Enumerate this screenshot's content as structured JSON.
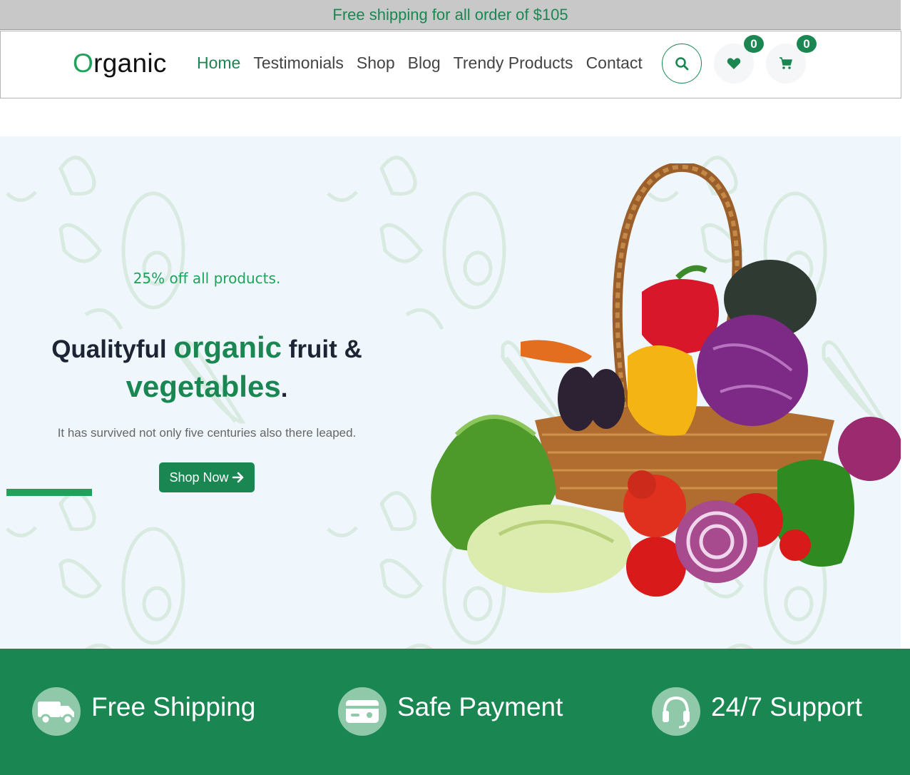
{
  "announcement": "Free shipping for all order of $105",
  "logo": {
    "first_letter": "O",
    "rest": "rganic"
  },
  "nav": [
    {
      "label": "Home",
      "active": true
    },
    {
      "label": "Testimonials"
    },
    {
      "label": "Shop"
    },
    {
      "label": "Blog"
    },
    {
      "label": "Trendy Products"
    },
    {
      "label": "Contact"
    }
  ],
  "icons": {
    "search": "search-icon",
    "wishlist": "heart-icon",
    "cart": "cart-icon"
  },
  "counts": {
    "wishlist": "0",
    "cart": "0"
  },
  "hero": {
    "promo": "25% off all products.",
    "headline": {
      "part1": "Qualityful ",
      "part2": "organic",
      "part3": " fruit & ",
      "part4": "vegetables",
      "part5": "."
    },
    "subtext": "It has survived not only five centuries also there leaped.",
    "cta": "Shop Now"
  },
  "features": [
    {
      "label": "Free Shipping",
      "icon": "truck-icon"
    },
    {
      "label": "Safe Payment",
      "icon": "credit-card-icon"
    },
    {
      "label": "24/7 Support",
      "icon": "headset-icon"
    }
  ],
  "colors": {
    "brand_green": "#1a8753",
    "accent_green": "#1fa35a",
    "hero_bg": "#eff6fc",
    "topbar_bg": "#c8c8c8"
  }
}
